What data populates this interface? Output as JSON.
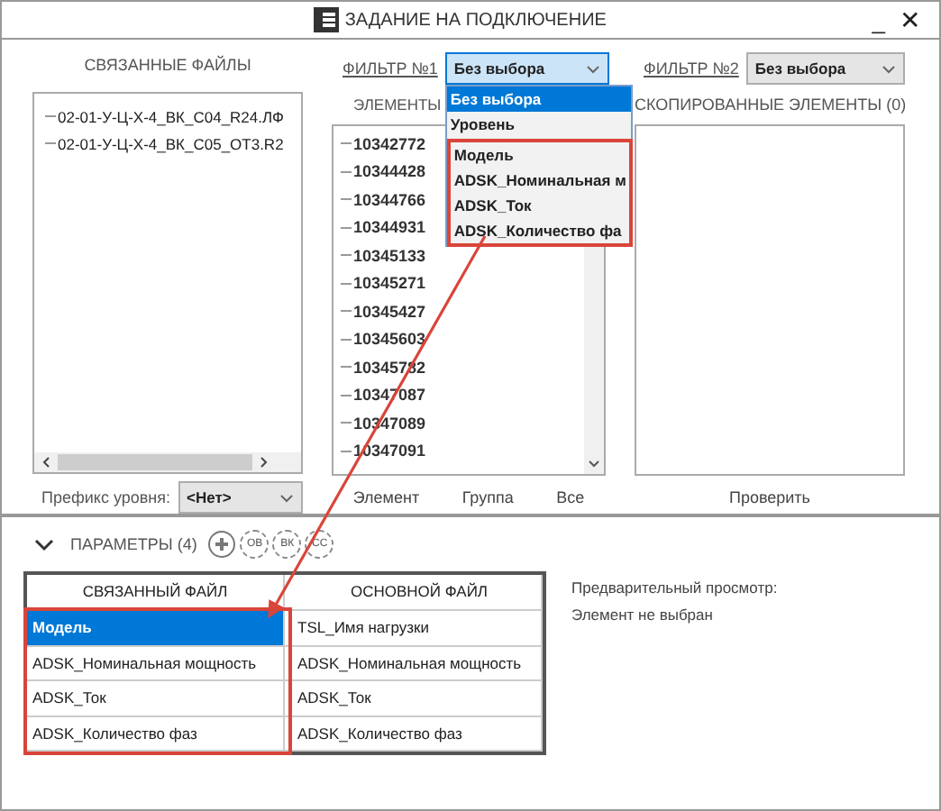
{
  "window": {
    "title": "ЗАДАНИЕ НА ПОДКЛЮЧЕНИЕ",
    "minimize": "_",
    "close": "✕"
  },
  "linked_files": {
    "title": "СВЯЗАННЫЕ ФАЙЛЫ",
    "items": [
      "02-01-У-Ц-Х-4_ВК_С04_R24.ЛФ",
      "02-01-У-Ц-Х-4_ВК_С05_ОТ3.R2"
    ],
    "prefix_label": "Префикс уровня:",
    "prefix_value": "<Нет>"
  },
  "filter1": {
    "label": "ФИЛЬТР №1",
    "value": "Без выбора",
    "expanded": true,
    "options": [
      {
        "label": "Без выбора",
        "selected": true,
        "highlighted": false
      },
      {
        "label": "Уровень",
        "selected": false,
        "highlighted": false
      },
      {
        "label": "Модель",
        "selected": false,
        "highlighted": true
      },
      {
        "label": "ADSK_Номинальная м",
        "selected": false,
        "highlighted": true
      },
      {
        "label": "ADSK_Ток",
        "selected": false,
        "highlighted": true
      },
      {
        "label": "ADSK_Количество фа",
        "selected": false,
        "highlighted": true
      }
    ]
  },
  "elements": {
    "title": "ЭЛЕМЕНТЫ",
    "items": [
      "10342772",
      "10344428",
      "10344766",
      "10344931",
      "10345133",
      "10345271",
      "10345427",
      "10345603",
      "10345782",
      "10347087",
      "10347089",
      "10347091"
    ],
    "buttons": [
      "Элемент",
      "Группа",
      "Все"
    ]
  },
  "filter2": {
    "label": "ФИЛЬТР №2",
    "value": "Без выбора"
  },
  "copied": {
    "title": "СКОПИРОВАННЫЕ ЭЛЕМЕНТЫ (0)",
    "button": "Проверить"
  },
  "parameters": {
    "title": "ПАРАМЕТРЫ (4)",
    "expanded": true,
    "tools": [
      {
        "kind": "add"
      },
      {
        "kind": "text",
        "label": "ОВ"
      },
      {
        "kind": "text",
        "label": "ВК"
      },
      {
        "kind": "text",
        "label": "СС"
      }
    ],
    "table": {
      "columns": [
        "СВЯЗАННЫЙ ФАЙЛ",
        "ОСНОВНОЙ ФАЙЛ"
      ],
      "linked_highlighted": true,
      "rows": [
        {
          "linked": "Модель",
          "main": "TSL_Имя нагрузки",
          "selected": true
        },
        {
          "linked": "ADSK_Номинальная мощность",
          "main": "ADSK_Номинальная мощность",
          "selected": false
        },
        {
          "linked": "ADSK_Ток",
          "main": "ADSK_Ток",
          "selected": false
        },
        {
          "linked": "ADSK_Количество фаз",
          "main": "ADSK_Количество фаз",
          "selected": false
        }
      ]
    },
    "preview": [
      "Предварительный просмотр:",
      "Элемент не выбран"
    ]
  },
  "annotation": {
    "arrow": true
  }
}
